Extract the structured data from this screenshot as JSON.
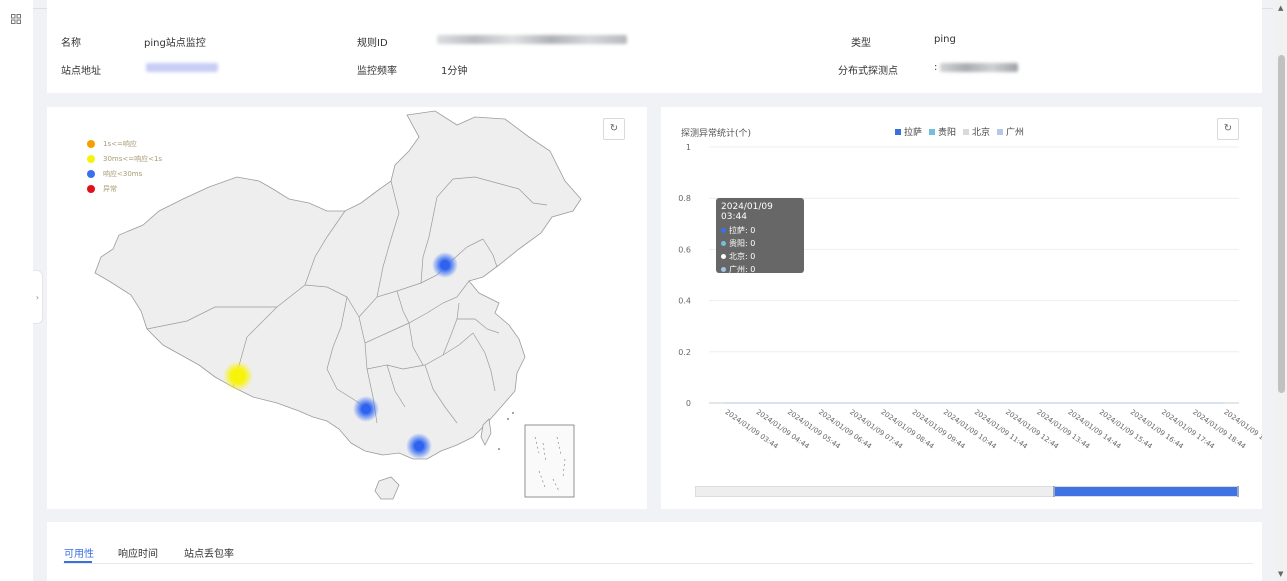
{
  "info": {
    "name_label": "名称",
    "name_value": "ping站点监控",
    "rule_id_label": "规则ID",
    "type_label": "类型",
    "type_value": "ping",
    "site_address_label": "站点地址",
    "frequency_label": "监控频率",
    "frequency_value": "1分钟",
    "distributed_label": "分布式探测点",
    "distributed_value_prefix": ":"
  },
  "map": {
    "legend": [
      {
        "label": "1s<=响应",
        "color": "#f5a000"
      },
      {
        "label": "30ms<=响应<1s",
        "color": "#f3f311"
      },
      {
        "label": "响应<30ms",
        "color": "#3a6ff0"
      },
      {
        "label": "异常",
        "color": "#e0111b"
      }
    ],
    "refresh_icon": "refresh-icon",
    "refresh_glyph": "↻"
  },
  "chart_panel": {
    "refresh_glyph": "↻",
    "tooltip": {
      "title": "2024/01/09 03:44",
      "rows": [
        {
          "label": "拉萨: 0",
          "color": "#3a6ff0"
        },
        {
          "label": "贵阳: 0",
          "color": "#73c0de"
        },
        {
          "label": "北京: 0",
          "color": "#ffffff"
        },
        {
          "label": "广州: 0",
          "color": "#9fc5e8"
        }
      ]
    }
  },
  "chart_data": {
    "type": "line",
    "title": "探测异常统计(个)",
    "x": [
      "2024/01/09 03:44",
      "2024/01/09 04:44",
      "2024/01/09 05:44",
      "2024/01/09 06:44",
      "2024/01/09 07:44",
      "2024/01/09 08:44",
      "2024/01/09 09:44",
      "2024/01/09 10:44",
      "2024/01/09 11:44",
      "2024/01/09 12:44",
      "2024/01/09 13:44",
      "2024/01/09 14:44",
      "2024/01/09 15:44",
      "2024/01/09 16:44",
      "2024/01/09 17:44",
      "2024/01/09 18:44",
      "2024/01/09 1"
    ],
    "yticks": [
      "0",
      "0.2",
      "0.4",
      "0.6",
      "0.8",
      "1"
    ],
    "ylim": [
      0,
      1
    ],
    "grid": true,
    "series": [
      {
        "name": "拉萨",
        "color": "#3a6fe0",
        "values": [
          0,
          0,
          0,
          0,
          0,
          0,
          0,
          0,
          0,
          0,
          0,
          0,
          0,
          0,
          0,
          0,
          0
        ]
      },
      {
        "name": "贵阳",
        "color": "#73c0de",
        "values": [
          0,
          0,
          0,
          0,
          0,
          0,
          0,
          0,
          0,
          0,
          0,
          0,
          0,
          0,
          0,
          0,
          0
        ]
      },
      {
        "name": "北京",
        "color": "#d9d9d9",
        "values": [
          0,
          0,
          0,
          0,
          0,
          0,
          0,
          0,
          0,
          0,
          0,
          0,
          0,
          0,
          0,
          0,
          0
        ]
      },
      {
        "name": "广州",
        "color": "#b4c7e7",
        "values": [
          0,
          0,
          0,
          0,
          0,
          0,
          0,
          0,
          0,
          0,
          0,
          0,
          0,
          0,
          0,
          0,
          0
        ]
      }
    ],
    "legend_position": "top-center"
  },
  "tabs": [
    {
      "label": "可用性",
      "active": true
    },
    {
      "label": "响应时间",
      "active": false
    },
    {
      "label": "站点丢包率",
      "active": false
    }
  ]
}
